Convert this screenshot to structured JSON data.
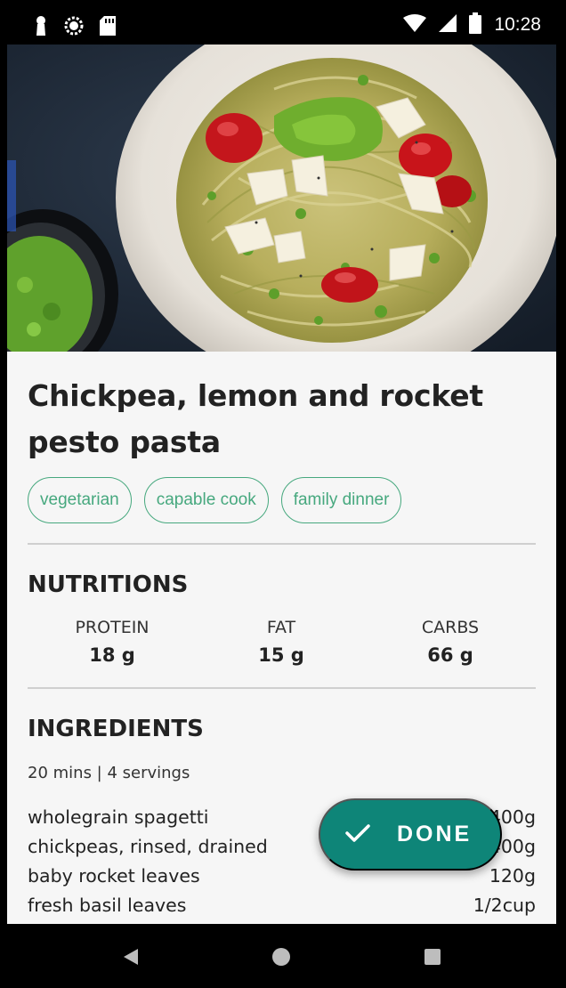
{
  "status_bar": {
    "time": "10:28",
    "left_icons": [
      "keyhole-icon",
      "sync-icon",
      "sd-card-icon"
    ],
    "right_icons": [
      "wifi-icon",
      "signal-icon",
      "battery-icon"
    ]
  },
  "recipe": {
    "title": "Chickpea, lemon and rocket pesto pasta",
    "tags": [
      "vegetarian",
      "capable cook",
      "family dinner"
    ],
    "nutrition_title": "NUTRITIONS",
    "nutrition": [
      {
        "label": "PROTEIN",
        "value": "18 g"
      },
      {
        "label": "FAT",
        "value": "15 g"
      },
      {
        "label": "CARBS",
        "value": "66 g"
      }
    ],
    "ingredients_title": "INGREDIENTS",
    "meta": "20 mins | 4 servings",
    "ingredients": [
      {
        "name": "wholegrain spagetti",
        "qty": "400g"
      },
      {
        "name": "chickpeas, rinsed, drained",
        "qty": "400g"
      },
      {
        "name": "baby rocket leaves",
        "qty": "120g"
      },
      {
        "name": "fresh basil leaves",
        "qty": "1/2cup"
      }
    ]
  },
  "fab": {
    "label": "DONE",
    "icon": "check-icon"
  },
  "nav": [
    "back-icon",
    "home-icon",
    "recents-icon"
  ],
  "colors": {
    "accent": "#46a87e",
    "fab": "#0e8578"
  }
}
